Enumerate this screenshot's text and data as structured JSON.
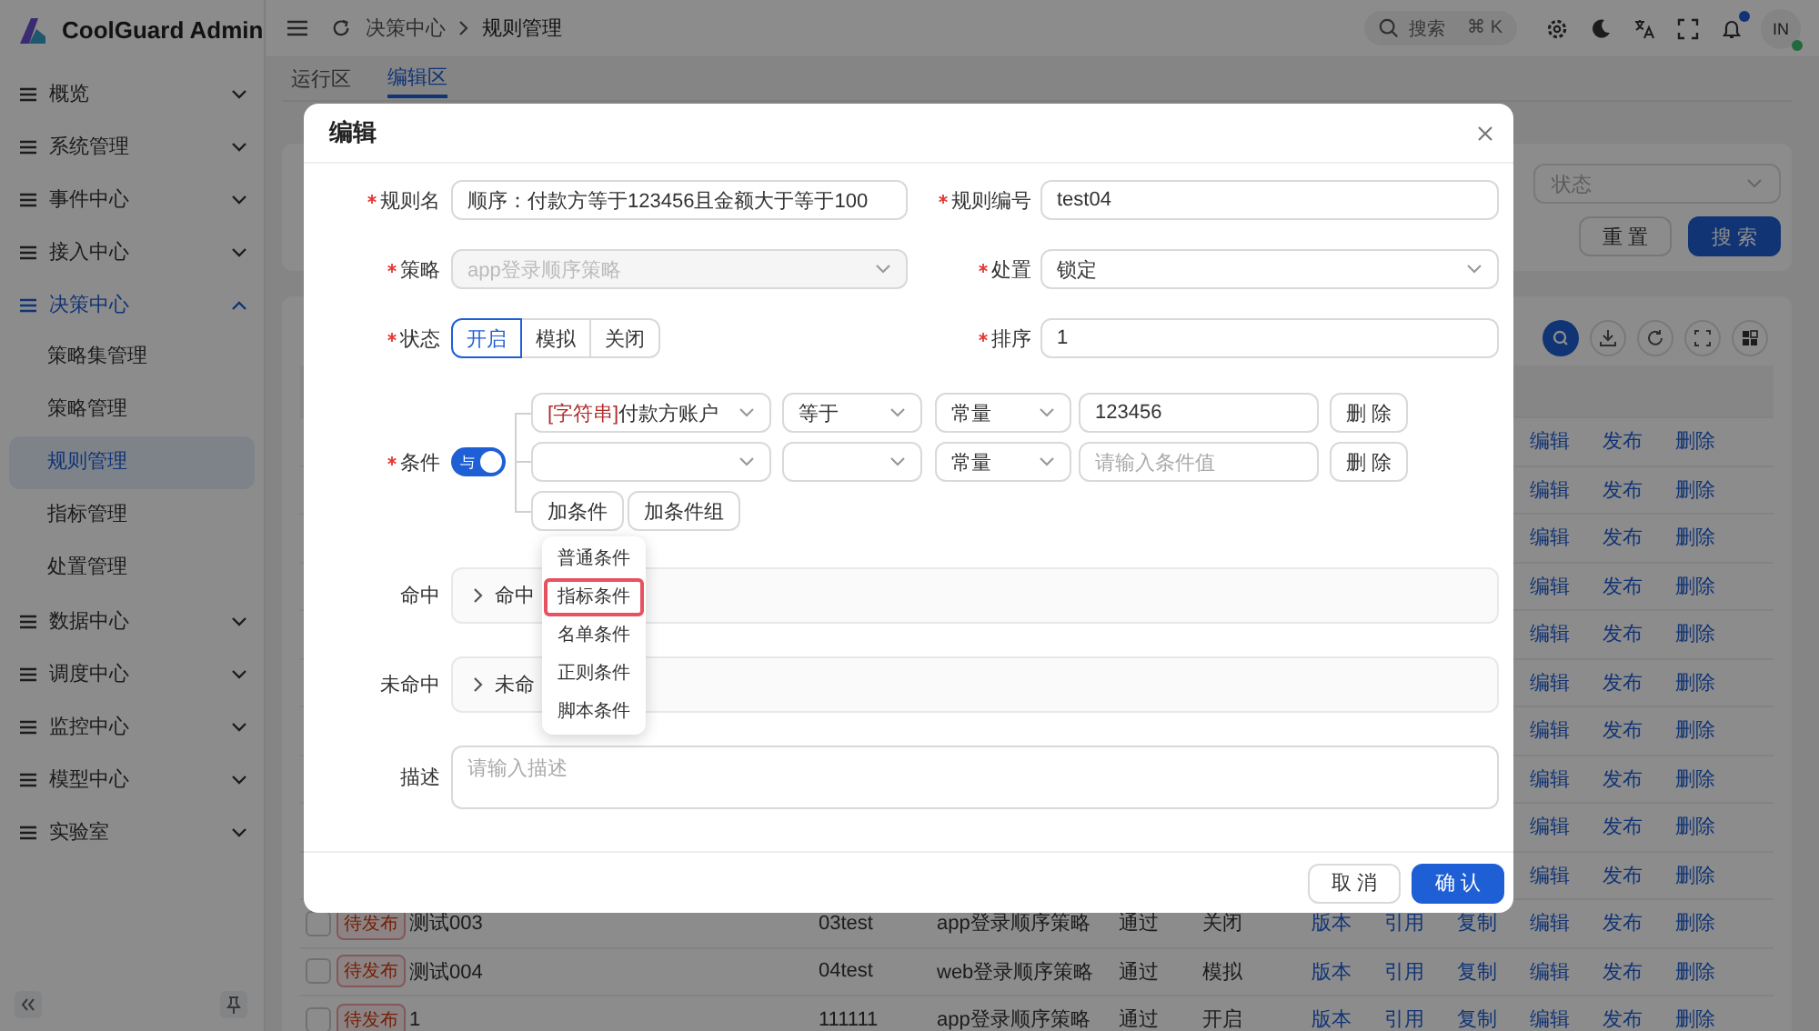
{
  "app": {
    "name": "CoolGuard Admin"
  },
  "sidebar": {
    "items": [
      {
        "label": "概览",
        "expanded": false
      },
      {
        "label": "系统管理",
        "expanded": false
      },
      {
        "label": "事件中心",
        "expanded": false
      },
      {
        "label": "接入中心",
        "expanded": false
      },
      {
        "label": "决策中心",
        "expanded": true,
        "children": [
          {
            "label": "策略集管理",
            "selected": false
          },
          {
            "label": "策略管理",
            "selected": false
          },
          {
            "label": "规则管理",
            "selected": true
          },
          {
            "label": "指标管理",
            "selected": false
          },
          {
            "label": "处置管理",
            "selected": false
          }
        ]
      },
      {
        "label": "数据中心",
        "expanded": false
      },
      {
        "label": "调度中心",
        "expanded": false
      },
      {
        "label": "监控中心",
        "expanded": false
      },
      {
        "label": "模型中心",
        "expanded": false
      },
      {
        "label": "实验室",
        "expanded": false
      }
    ]
  },
  "topbar": {
    "breadcrumb": [
      "决策中心",
      "规则管理"
    ],
    "search": {
      "placeholder": "搜索",
      "shortcut": "⌘ K"
    },
    "unread": true,
    "avatar": {
      "initials": "IN",
      "online": true
    }
  },
  "tabs": [
    {
      "label": "运行区",
      "selected": false
    },
    {
      "label": "编辑区",
      "selected": true
    }
  ],
  "filters": {
    "fields": [
      {
        "placeholder": "状态"
      }
    ],
    "buttons": [
      {
        "label": "重 置",
        "primary": false
      },
      {
        "label": "搜 索",
        "primary": true
      }
    ]
  },
  "table": {
    "rows": [
      {
        "actions": [
          "编辑",
          "发布",
          "删除"
        ]
      },
      {
        "actions": [
          "编辑",
          "发布",
          "删除"
        ]
      },
      {
        "actions": [
          "编辑",
          "发布",
          "删除"
        ]
      },
      {
        "actions": [
          "编辑",
          "发布",
          "删除"
        ]
      },
      {
        "actions": [
          "编辑",
          "发布",
          "删除"
        ]
      },
      {
        "actions": [
          "编辑",
          "发布",
          "删除"
        ]
      },
      {
        "actions": [
          "编辑",
          "发布",
          "删除"
        ]
      },
      {
        "actions": [
          "编辑",
          "发布",
          "删除"
        ]
      },
      {
        "actions": [
          "编辑",
          "发布",
          "删除"
        ]
      },
      {
        "actions": [
          "编辑",
          "发布",
          "删除"
        ]
      },
      {
        "checked": false,
        "tag": "待发布",
        "name": "测试003",
        "code": "03test",
        "strategy": "app登录顺序策略",
        "result": "通过",
        "status": "关闭",
        "actions": [
          "版本",
          "引用",
          "复制",
          "编辑",
          "发布",
          "删除"
        ]
      },
      {
        "checked": false,
        "tag": "待发布",
        "name": "测试004",
        "code": "04test",
        "strategy": "web登录顺序策略",
        "result": "通过",
        "status": "模拟",
        "actions": [
          "版本",
          "引用",
          "复制",
          "编辑",
          "发布",
          "删除"
        ]
      },
      {
        "checked": false,
        "tag": "待发布",
        "name": "1",
        "code": "111111",
        "strategy": "app登录顺序策略",
        "result": "通过",
        "status": "开启",
        "actions": [
          "版本",
          "引用",
          "复制",
          "编辑",
          "发布",
          "删除"
        ]
      }
    ]
  },
  "modal": {
    "title": "编辑",
    "fields": [
      {
        "kind": "input",
        "label": "规则名",
        "required": true,
        "value": "顺序：付款方等于123456且金额大于等于100"
      },
      {
        "kind": "input",
        "label": "规则编号",
        "required": true,
        "value": "test04"
      },
      {
        "kind": "select",
        "label": "策略",
        "required": true,
        "value": "app登录顺序策略",
        "disabled": true
      },
      {
        "kind": "select",
        "label": "处置",
        "required": true,
        "value": "锁定",
        "disabled": false
      },
      {
        "kind": "radio",
        "label": "状态",
        "required": true,
        "options": [
          {
            "label": "开启",
            "selected": true
          },
          {
            "label": "模拟",
            "selected": false
          },
          {
            "label": "关闭",
            "selected": false
          }
        ]
      },
      {
        "kind": "input",
        "label": "排序",
        "required": true,
        "value": "1"
      }
    ],
    "conditions": {
      "label": "条件",
      "required": true,
      "logic": {
        "label": "与",
        "on": true
      },
      "rows": [
        {
          "field_type": "[字符串]",
          "field": "付款方账户",
          "operator": "等于",
          "value_type": "常量",
          "value": "123456",
          "delete": "删 除"
        },
        {
          "value_type": "常量",
          "placeholder": "请输入条件值",
          "delete": "删 除"
        }
      ],
      "buttons": [
        "加条件",
        "加条件组"
      ],
      "menu": [
        {
          "label": "普通条件",
          "selected": false
        },
        {
          "label": "指标条件",
          "selected": true
        },
        {
          "label": "名单条件",
          "selected": false
        },
        {
          "label": "正则条件",
          "selected": false
        },
        {
          "label": "脚本条件",
          "selected": false
        }
      ]
    },
    "panels": [
      {
        "label": "命中",
        "text": "命中",
        "expanded": false
      },
      {
        "label": "未命中",
        "text": "未命",
        "expanded": false
      }
    ],
    "description": {
      "label": "描述",
      "placeholder": "请输入描述"
    },
    "buttons": [
      {
        "label": "取 消",
        "primary": false
      },
      {
        "label": "确 认",
        "primary": true
      }
    ]
  }
}
